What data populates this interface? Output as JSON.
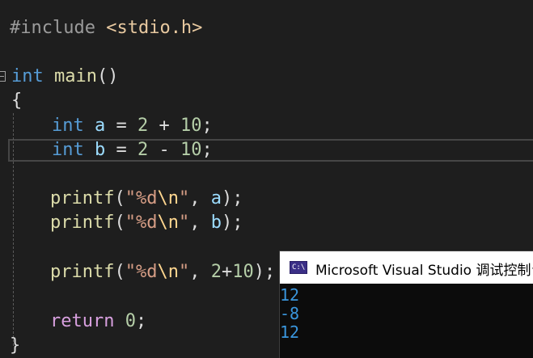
{
  "editor": {
    "line_include": {
      "directive": "#include",
      "header": "<stdio.h>"
    },
    "line_main": {
      "type": "int",
      "name": "main",
      "parens": "()"
    },
    "open_brace": "{",
    "line_a": {
      "type": "int",
      "var": "a",
      "op_eq": "=",
      "lhs": "2",
      "op": "+",
      "rhs": "10",
      "semi": ";"
    },
    "line_b": {
      "type": "int",
      "var": "b",
      "op_eq": "=",
      "lhs": "2",
      "op": "-",
      "rhs": "10",
      "semi": ";"
    },
    "printf_a": {
      "fn": "printf",
      "open": "(",
      "fmt": "\"%d",
      "esc": "\\n",
      "fmt_end": "\"",
      "sep": ", ",
      "arg": "a",
      "close": ");"
    },
    "printf_b": {
      "fn": "printf",
      "open": "(",
      "fmt": "\"%d",
      "esc": "\\n",
      "fmt_end": "\"",
      "sep": ", ",
      "arg": "b",
      "close": ");"
    },
    "printf_sum": {
      "fn": "printf",
      "open": "(",
      "fmt": "\"%d",
      "esc": "\\n",
      "fmt_end": "\"",
      "sep": ", ",
      "lhs": "2",
      "op": "+",
      "rhs": "10",
      "close": ");"
    },
    "line_return": {
      "kw": "return",
      "val": "0",
      "semi": ";"
    },
    "close_brace": "}"
  },
  "console": {
    "icon_label": "C:\\",
    "title": "Microsoft Visual Studio 调试控制台",
    "output": [
      "12",
      "-8",
      "12"
    ]
  },
  "colors": {
    "background": "#1e1e1e",
    "keyword": "#569cd6",
    "function": "#dcdcaa",
    "variable": "#9cdcfe",
    "number": "#b5cea8",
    "string": "#d69d85",
    "console_text": "#3a96dd"
  },
  "icons": {
    "fold": "collapse-icon",
    "console": "console-app-icon"
  }
}
